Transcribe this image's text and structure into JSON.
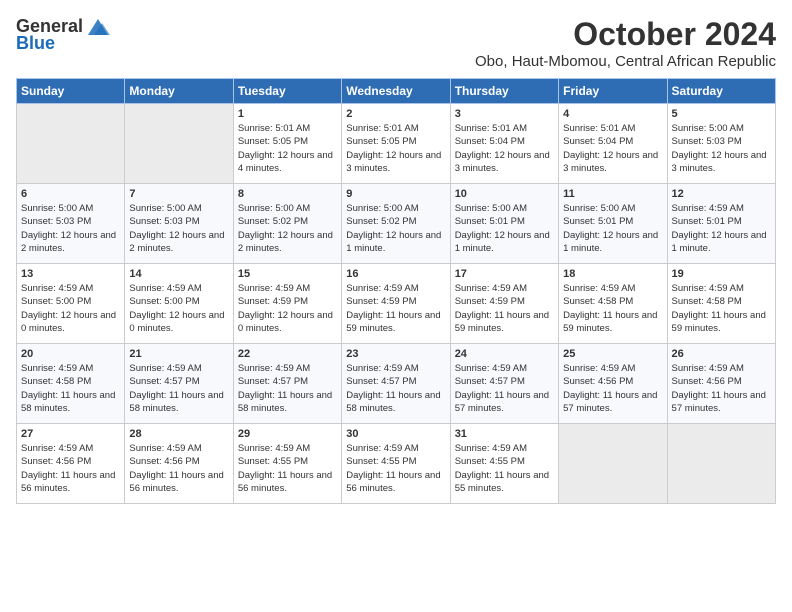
{
  "header": {
    "logo_general": "General",
    "logo_blue": "Blue",
    "month_title": "October 2024",
    "subtitle": "Obo, Haut-Mbomou, Central African Republic"
  },
  "days_of_week": [
    "Sunday",
    "Monday",
    "Tuesday",
    "Wednesday",
    "Thursday",
    "Friday",
    "Saturday"
  ],
  "weeks": [
    [
      {
        "day": "",
        "info": ""
      },
      {
        "day": "",
        "info": ""
      },
      {
        "day": "1",
        "info": "Sunrise: 5:01 AM\nSunset: 5:05 PM\nDaylight: 12 hours and 4 minutes."
      },
      {
        "day": "2",
        "info": "Sunrise: 5:01 AM\nSunset: 5:05 PM\nDaylight: 12 hours and 3 minutes."
      },
      {
        "day": "3",
        "info": "Sunrise: 5:01 AM\nSunset: 5:04 PM\nDaylight: 12 hours and 3 minutes."
      },
      {
        "day": "4",
        "info": "Sunrise: 5:01 AM\nSunset: 5:04 PM\nDaylight: 12 hours and 3 minutes."
      },
      {
        "day": "5",
        "info": "Sunrise: 5:00 AM\nSunset: 5:03 PM\nDaylight: 12 hours and 3 minutes."
      }
    ],
    [
      {
        "day": "6",
        "info": "Sunrise: 5:00 AM\nSunset: 5:03 PM\nDaylight: 12 hours and 2 minutes."
      },
      {
        "day": "7",
        "info": "Sunrise: 5:00 AM\nSunset: 5:03 PM\nDaylight: 12 hours and 2 minutes."
      },
      {
        "day": "8",
        "info": "Sunrise: 5:00 AM\nSunset: 5:02 PM\nDaylight: 12 hours and 2 minutes."
      },
      {
        "day": "9",
        "info": "Sunrise: 5:00 AM\nSunset: 5:02 PM\nDaylight: 12 hours and 1 minute."
      },
      {
        "day": "10",
        "info": "Sunrise: 5:00 AM\nSunset: 5:01 PM\nDaylight: 12 hours and 1 minute."
      },
      {
        "day": "11",
        "info": "Sunrise: 5:00 AM\nSunset: 5:01 PM\nDaylight: 12 hours and 1 minute."
      },
      {
        "day": "12",
        "info": "Sunrise: 4:59 AM\nSunset: 5:01 PM\nDaylight: 12 hours and 1 minute."
      }
    ],
    [
      {
        "day": "13",
        "info": "Sunrise: 4:59 AM\nSunset: 5:00 PM\nDaylight: 12 hours and 0 minutes."
      },
      {
        "day": "14",
        "info": "Sunrise: 4:59 AM\nSunset: 5:00 PM\nDaylight: 12 hours and 0 minutes."
      },
      {
        "day": "15",
        "info": "Sunrise: 4:59 AM\nSunset: 4:59 PM\nDaylight: 12 hours and 0 minutes."
      },
      {
        "day": "16",
        "info": "Sunrise: 4:59 AM\nSunset: 4:59 PM\nDaylight: 11 hours and 59 minutes."
      },
      {
        "day": "17",
        "info": "Sunrise: 4:59 AM\nSunset: 4:59 PM\nDaylight: 11 hours and 59 minutes."
      },
      {
        "day": "18",
        "info": "Sunrise: 4:59 AM\nSunset: 4:58 PM\nDaylight: 11 hours and 59 minutes."
      },
      {
        "day": "19",
        "info": "Sunrise: 4:59 AM\nSunset: 4:58 PM\nDaylight: 11 hours and 59 minutes."
      }
    ],
    [
      {
        "day": "20",
        "info": "Sunrise: 4:59 AM\nSunset: 4:58 PM\nDaylight: 11 hours and 58 minutes."
      },
      {
        "day": "21",
        "info": "Sunrise: 4:59 AM\nSunset: 4:57 PM\nDaylight: 11 hours and 58 minutes."
      },
      {
        "day": "22",
        "info": "Sunrise: 4:59 AM\nSunset: 4:57 PM\nDaylight: 11 hours and 58 minutes."
      },
      {
        "day": "23",
        "info": "Sunrise: 4:59 AM\nSunset: 4:57 PM\nDaylight: 11 hours and 58 minutes."
      },
      {
        "day": "24",
        "info": "Sunrise: 4:59 AM\nSunset: 4:57 PM\nDaylight: 11 hours and 57 minutes."
      },
      {
        "day": "25",
        "info": "Sunrise: 4:59 AM\nSunset: 4:56 PM\nDaylight: 11 hours and 57 minutes."
      },
      {
        "day": "26",
        "info": "Sunrise: 4:59 AM\nSunset: 4:56 PM\nDaylight: 11 hours and 57 minutes."
      }
    ],
    [
      {
        "day": "27",
        "info": "Sunrise: 4:59 AM\nSunset: 4:56 PM\nDaylight: 11 hours and 56 minutes."
      },
      {
        "day": "28",
        "info": "Sunrise: 4:59 AM\nSunset: 4:56 PM\nDaylight: 11 hours and 56 minutes."
      },
      {
        "day": "29",
        "info": "Sunrise: 4:59 AM\nSunset: 4:55 PM\nDaylight: 11 hours and 56 minutes."
      },
      {
        "day": "30",
        "info": "Sunrise: 4:59 AM\nSunset: 4:55 PM\nDaylight: 11 hours and 56 minutes."
      },
      {
        "day": "31",
        "info": "Sunrise: 4:59 AM\nSunset: 4:55 PM\nDaylight: 11 hours and 55 minutes."
      },
      {
        "day": "",
        "info": ""
      },
      {
        "day": "",
        "info": ""
      }
    ]
  ]
}
